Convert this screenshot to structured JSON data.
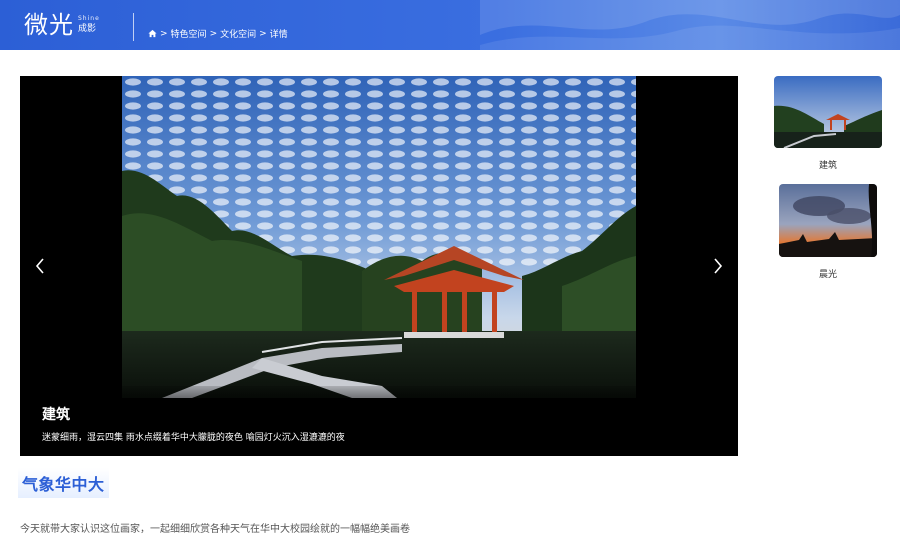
{
  "header": {
    "logo_main": "微光",
    "logo_en": "Shine",
    "logo_cn": "成影",
    "breadcrumb": [
      "特色空间",
      "文化空间",
      "详情"
    ],
    "separator": ">",
    "home_icon": "home-icon",
    "bg_color": "#2c5fd6"
  },
  "slider": {
    "current_title": "建筑",
    "current_desc": "迷蒙细雨，湿云四集 雨水点缀着华中大朦胧的夜色 喻园灯火沉入湿漉漉的夜",
    "prev_icon": "chevron-left-icon",
    "next_icon": "chevron-right-icon"
  },
  "thumbnails": [
    {
      "label": "建筑"
    },
    {
      "label": "晨光"
    }
  ],
  "section": {
    "title": "气象华中大",
    "intro": "今天就带大家认识这位画家，一起细细欣赏各种天气在华中大校园绘就的一幅幅绝美画卷"
  },
  "colors": {
    "accent": "#2c5fd6",
    "pavilion": "#c2431f"
  }
}
